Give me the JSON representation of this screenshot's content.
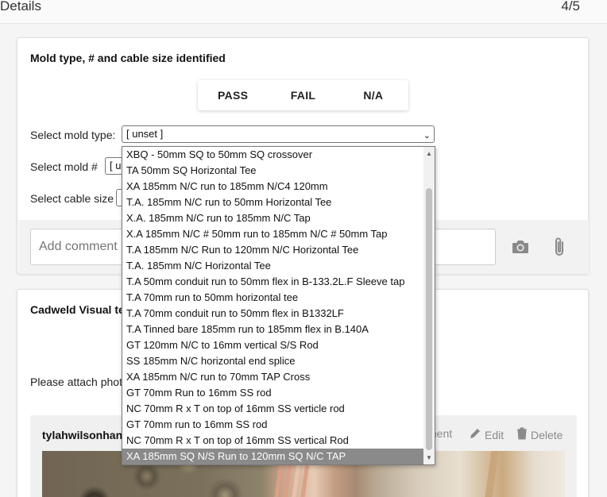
{
  "header": {
    "title": "Details",
    "step": "4/5"
  },
  "card1": {
    "title": "Mold type, # and cable size identified",
    "pfn_buttons": [
      "PASS",
      "FAIL",
      "N/A"
    ],
    "fields": [
      {
        "label": "Select mold type:",
        "value": "[ unset ]"
      },
      {
        "label": "Select mold #",
        "value": "[ u"
      },
      {
        "label": "Select cable size",
        "value": ""
      }
    ],
    "comment_placeholder": "Add comment"
  },
  "card2": {
    "title": "Cadweld Visual te",
    "attach_label": "Please attach photo",
    "photo": {
      "user": "tylahwilsonhann",
      "comment_label": "ment",
      "edit_label": "Edit",
      "delete_label": "Delete"
    }
  },
  "dropdown": {
    "options": [
      "XBQ - 50mm SQ to 50mm SQ crossover",
      "TA 50mm SQ Horizontal Tee",
      "XA 185mm N/C run to 185mm N/C4 120mm",
      "T.A. 185mm N/C run to 50mm Horizontal Tee",
      "X.A. 185mm N/C run to 185mm N/C Tap",
      "X.A 185mm N/C # 50mm run to 185mm N/C # 50mm Tap",
      "T.A 185mm N/C Run to 120mm N/C Horizontal Tee",
      "T.A. 185mm N/C Horizontal Tee",
      "T.A 50mm conduit run to 50mm flex in B-133.2L.F Sleeve tap",
      "T.A 70mm run to 50mm horizontal tee",
      "T.A 70mm conduit run to 50mm flex in B1332LF",
      "T.A Tinned bare 185mm run to 185mm flex in B.140A",
      "GT 120mm N/C to 16mm vertical S/S Rod",
      "SS 185mm N/C horizontal end splice",
      "XA 185mm N/C run to 70mm TAP Cross",
      "GT 70mm Run to 16mm SS rod",
      "NC 70mm R x T on top of 16mm SS verticle rod",
      "GT 70mm run to 16mm SS rod",
      "NC 70mm R x T on top of 16mm SS vertical Rod",
      "XA 185mm SQ N/S Run to 120mm SQ N/C TAP"
    ],
    "highlighted_index": 19
  }
}
